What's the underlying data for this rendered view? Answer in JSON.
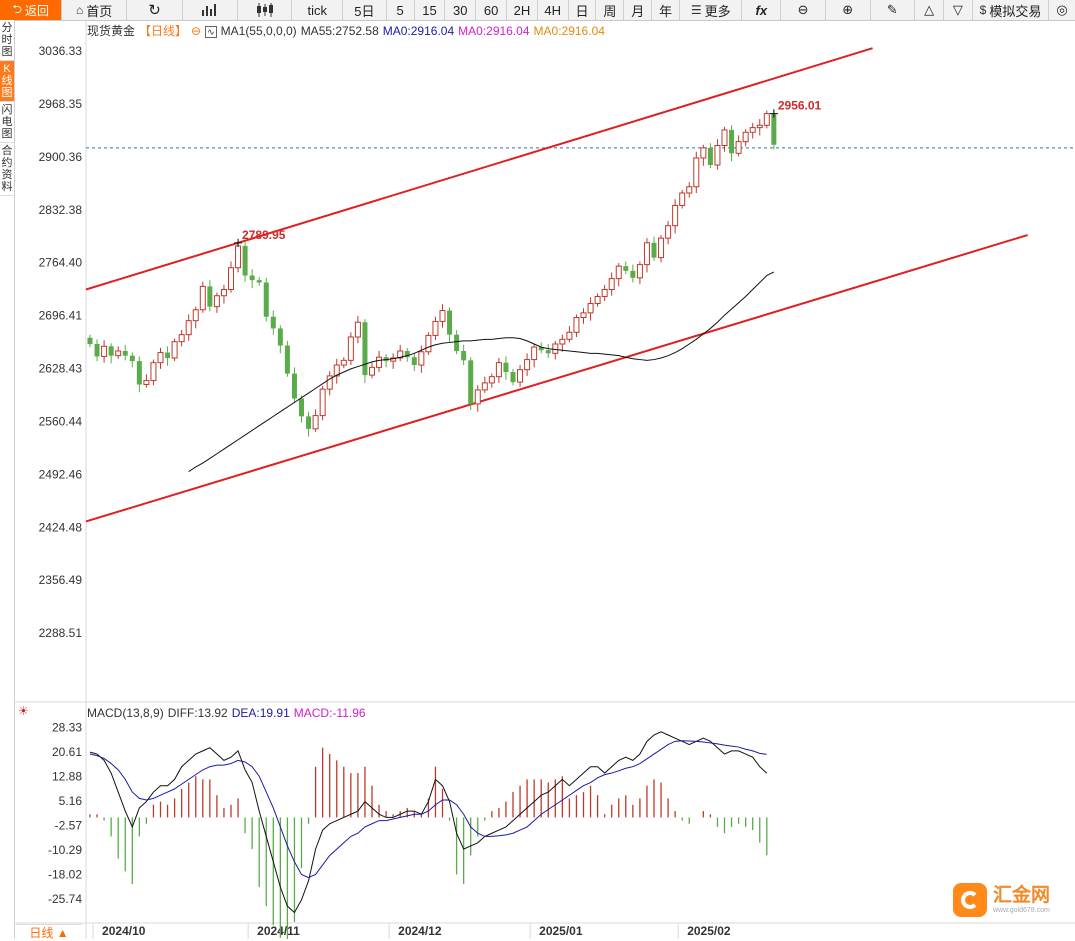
{
  "toolbar": {
    "back": "返回",
    "home": "首页",
    "refresh": "",
    "tick": "tick",
    "periods": [
      "5日",
      "5",
      "15",
      "30",
      "60",
      "2H",
      "4H",
      "日",
      "周",
      "月",
      "年"
    ],
    "more": "更多",
    "fx": "fx",
    "sim": "模拟交易"
  },
  "sidebar": {
    "tabs": [
      "分时图",
      "K线图",
      "闪电图",
      "合约资料"
    ],
    "active": 1
  },
  "header": {
    "instrument": "现货黄金",
    "period": "【日线】",
    "ma_label": "MA1(55,0,0,0)",
    "ma55": "MA55:2752.58",
    "ma0a": "MA0:2916.04",
    "ma0b": "MA0:2916.04",
    "ma0c": "MA0:2916.04"
  },
  "macd_header": {
    "label": "MACD(13,8,9)",
    "diff": "DIFF:13.92",
    "dea": "DEA:19.91",
    "macd": "MACD:-11.96"
  },
  "period_button": "日线 ▲",
  "logo": {
    "name": "汇金网",
    "url": "www.gold678.com"
  },
  "colors": {
    "up": "#c0392b",
    "down": "#5aab4a",
    "trend": "#e02020",
    "ma55": "#111111",
    "dea": "#1a1aa6",
    "macd_label": "#d01fd0",
    "accent": "#ff6a00"
  },
  "chart_data": [
    {
      "type": "candlestick",
      "title": "现货黄金",
      "y_ticks": [
        "3036.33",
        "2968.35",
        "2900.36",
        "2832.38",
        "2764.40",
        "2696.41",
        "2628.43",
        "2560.44",
        "2492.46",
        "2424.48",
        "2356.49",
        "2288.51"
      ],
      "ylim": [
        2254,
        3048
      ],
      "x_ticks": [
        {
          "label": "2024/10",
          "index": 1
        },
        {
          "label": "2024/11",
          "index": 23
        },
        {
          "label": "2024/12",
          "index": 43
        },
        {
          "label": "2025/01",
          "index": 63
        },
        {
          "label": "2025/02",
          "index": 84
        }
      ],
      "annotations": [
        {
          "text": "2789.95",
          "index": 21,
          "value": 2789.95
        },
        {
          "text": "2956.01",
          "index": 97,
          "value": 2956.01
        }
      ],
      "reference_line": 2912,
      "trend_channel": {
        "upper": [
          [
            0,
            2730
          ],
          [
            111,
            3040
          ]
        ],
        "lower": [
          [
            0,
            2432
          ],
          [
            133,
            2800
          ]
        ]
      },
      "closes": [
        2660,
        2644,
        2657,
        2645,
        2651,
        2645,
        2638,
        2608,
        2613,
        2636,
        2649,
        2642,
        2663,
        2672,
        2690,
        2704,
        2734,
        2708,
        2722,
        2730,
        2758,
        2786,
        2748,
        2742,
        2739,
        2695,
        2680,
        2658,
        2622,
        2590,
        2567,
        2551,
        2568,
        2602,
        2619,
        2633,
        2639,
        2669,
        2688,
        2620,
        2630,
        2643,
        2638,
        2642,
        2651,
        2643,
        2633,
        2650,
        2671,
        2689,
        2703,
        2672,
        2651,
        2639,
        2583,
        2601,
        2610,
        2618,
        2636,
        2624,
        2611,
        2627,
        2640,
        2656,
        2652,
        2648,
        2660,
        2666,
        2675,
        2694,
        2700,
        2712,
        2721,
        2730,
        2744,
        2760,
        2754,
        2745,
        2762,
        2790,
        2771,
        2796,
        2812,
        2838,
        2854,
        2862,
        2899,
        2912,
        2890,
        2915,
        2935,
        2905,
        2920,
        2932,
        2938,
        2941,
        2956,
        2916
      ],
      "series": [
        {
          "name": "MA55",
          "values": [
            2496,
            2502,
            2507,
            2513,
            2519,
            2525,
            2531,
            2537,
            2543,
            2549,
            2555,
            2561,
            2567,
            2573,
            2579,
            2585,
            2591,
            2597,
            2603,
            2609,
            2615,
            2620,
            2624,
            2628,
            2631,
            2634,
            2637,
            2639,
            2640,
            2641,
            2643,
            2645,
            2648,
            2652,
            2656,
            2659,
            2661,
            2662,
            2663,
            2664,
            2664,
            2665,
            2666,
            2666,
            2667,
            2668,
            2668,
            2667,
            2664,
            2660,
            2656,
            2654,
            2653,
            2652,
            2651,
            2650,
            2649,
            2648,
            2648,
            2647,
            2646,
            2645,
            2643,
            2641,
            2640,
            2639,
            2640,
            2642,
            2645,
            2649,
            2654,
            2660,
            2666,
            2673,
            2680,
            2688,
            2697,
            2705,
            2713,
            2721,
            2730,
            2739,
            2748,
            2752.58
          ]
        }
      ]
    },
    {
      "type": "macd",
      "title": "MACD(13,8,9)",
      "y_ticks": [
        "28.33",
        "20.61",
        "12.88",
        "5.16",
        "-2.57",
        "-10.29",
        "-18.02",
        "-25.74"
      ],
      "ylim": [
        -33,
        32
      ],
      "series": [
        {
          "name": "DIFF",
          "values": [
            20.6,
            20,
            18,
            14,
            8,
            2,
            -3,
            3,
            5,
            8,
            10,
            10,
            12,
            16,
            18,
            20,
            21,
            22,
            20,
            18,
            19,
            21,
            15,
            11,
            2,
            -6,
            -14,
            -22,
            -28,
            -30,
            -26,
            -20,
            -10,
            -4,
            -2,
            -1,
            0,
            1,
            2,
            5,
            3,
            1,
            0,
            0,
            1,
            2,
            2,
            1,
            5,
            12,
            10,
            5,
            -5,
            -10,
            -9,
            -8,
            -6,
            -5,
            -4,
            -3,
            -1,
            1,
            3,
            5,
            7,
            8,
            10,
            12,
            10,
            12,
            14,
            16,
            16,
            14,
            16,
            18,
            19,
            18,
            20,
            24,
            26,
            27,
            26,
            25,
            24,
            23,
            24,
            25,
            24,
            22,
            20,
            21,
            21,
            20,
            19,
            16,
            13.92
          ]
        },
        {
          "name": "DEA",
          "values": [
            20,
            19.5,
            18.6,
            17,
            15,
            12,
            8,
            6,
            5.5,
            6,
            7,
            8,
            9,
            10.5,
            12,
            13.5,
            15,
            16,
            16.5,
            16.5,
            17,
            18,
            17.5,
            16,
            13,
            8,
            3,
            -3,
            -9,
            -14,
            -18,
            -19,
            -18,
            -15,
            -12,
            -10,
            -8,
            -6,
            -5,
            -3,
            -2,
            -1,
            -1,
            -0.5,
            0,
            0.5,
            1,
            1,
            2,
            4,
            5.5,
            5.5,
            4,
            1,
            -3,
            -5,
            -6,
            -6,
            -5.8,
            -5.5,
            -5,
            -4,
            -3,
            -1,
            1,
            2.5,
            4,
            5.5,
            7,
            8.5,
            10,
            11,
            12.5,
            13.5,
            14,
            14.7,
            15.5,
            16,
            17,
            18.5,
            20,
            21.5,
            23,
            24,
            24.2,
            24.1,
            24,
            23.8,
            23.5,
            23.2,
            22.8,
            22.5,
            22.2,
            21.5,
            21,
            20.2,
            19.91
          ]
        },
        {
          "name": "MACD",
          "values": [
            1,
            1,
            -1,
            -6,
            -13,
            -17,
            -21,
            -6,
            -2,
            4,
            5,
            4,
            6,
            9,
            11,
            13,
            12,
            12,
            7,
            3,
            4,
            6,
            -5,
            -10,
            -22,
            -28,
            -34,
            -38,
            -40,
            -33,
            -16,
            -2,
            16,
            22,
            20,
            18,
            16,
            14,
            14,
            16,
            10,
            4,
            2,
            1,
            2,
            3,
            2,
            1,
            6,
            16,
            9,
            -1,
            -18,
            -21,
            -12,
            -6,
            -1,
            2,
            3,
            5,
            8,
            10,
            12,
            12,
            12,
            11,
            12,
            13,
            6,
            7,
            8,
            10,
            7,
            1,
            4,
            6,
            7,
            4,
            6,
            10,
            12,
            11,
            6,
            2,
            -1,
            -2,
            0,
            2,
            1,
            -3,
            -5,
            -3,
            -2,
            -3,
            -4,
            -8,
            -11.96
          ]
        }
      ]
    }
  ]
}
